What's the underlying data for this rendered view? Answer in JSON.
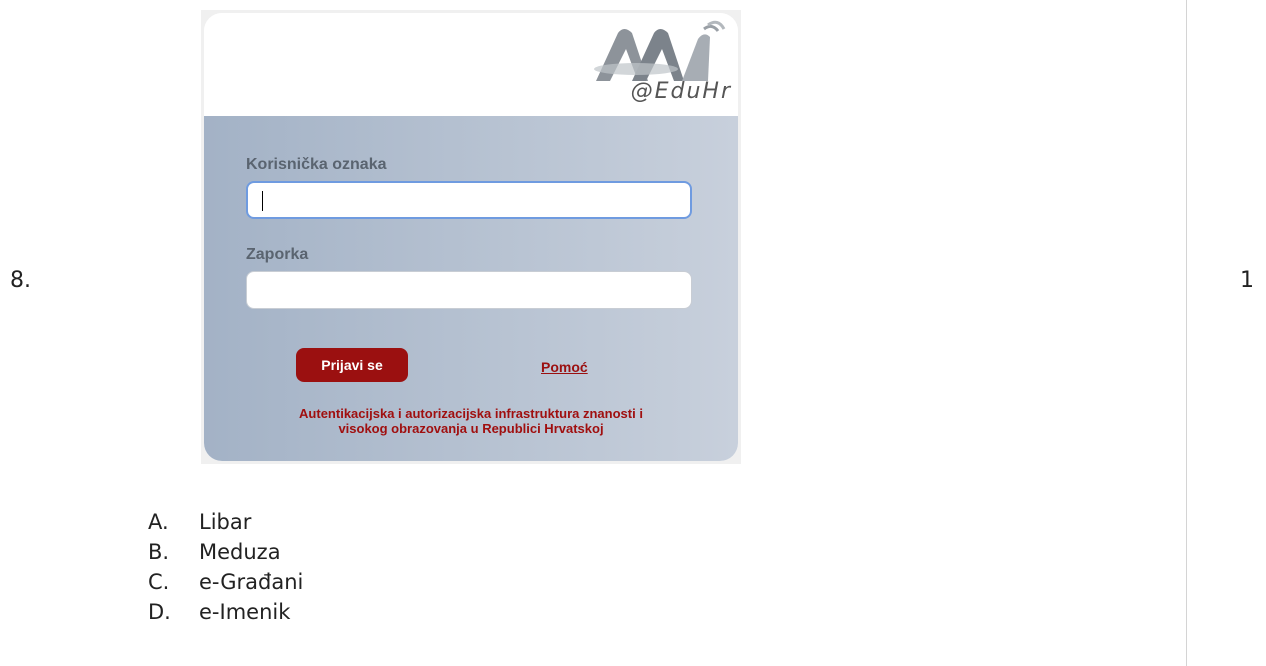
{
  "question": {
    "number": "8.",
    "points": "1"
  },
  "screenshot": {
    "logo_text": "@EduHr",
    "username_label": "Korisnička oznaka",
    "password_label": "Zaporka",
    "username_value": "",
    "password_value": "",
    "login_button": "Prijavi se",
    "help_link": "Pomoć",
    "footer_line1": "Autentikacijska i autorizacijska infrastruktura znanosti i",
    "footer_line2": "visokog obrazovanja u Republici Hrvatskoj",
    "colors": {
      "accent": "#9b1010",
      "panel": "#b9c4d3"
    },
    "icons": {
      "logo": "aai-logo-icon"
    }
  },
  "options": [
    {
      "letter": "A.",
      "text": "Libar"
    },
    {
      "letter": "B.",
      "text": "Meduza"
    },
    {
      "letter": "C.",
      "text": "e-Građani"
    },
    {
      "letter": "D.",
      "text": "e-Imenik"
    }
  ]
}
